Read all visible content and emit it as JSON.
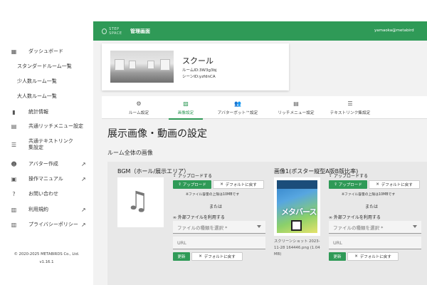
{
  "sidebar": {
    "items": [
      {
        "label": "ダッシュボード",
        "icon": "dashboard-icon"
      },
      {
        "label": "スタンダードルーム一覧"
      },
      {
        "label": "少人数ルーム一覧"
      },
      {
        "label": "大人数ルーム一覧"
      },
      {
        "label": "統計情報",
        "icon": "bar-chart-icon"
      },
      {
        "label": "共通リッチメニュー設定",
        "icon": "book-icon"
      },
      {
        "label": "共通テキストリンク集設定",
        "icon": "list-icon"
      },
      {
        "label": "アバター作成",
        "icon": "avatar-icon"
      },
      {
        "label": "操作マニュアル",
        "icon": "manual-icon"
      },
      {
        "label": "お問い合わせ",
        "icon": "help-icon"
      },
      {
        "label": "利用規約",
        "icon": "document-icon"
      },
      {
        "label": "プライバシーポリシー",
        "icon": "document-icon"
      }
    ],
    "copyright": "© 2020-2025 METABIRDS Co., Ltd.",
    "version": "v1.16.1"
  },
  "header": {
    "logo_text": "STEP SPACE",
    "title": "管理画面",
    "user": "yamaoka@metabird"
  },
  "room": {
    "name": "スクール",
    "room_id": "ルームID:3W3g3bj",
    "scene_id": "シーンID:yzfdnCA"
  },
  "tabs": [
    {
      "label": "ルーム設定",
      "icon": "gear-icon"
    },
    {
      "label": "画像設定",
      "icon": "image-icon"
    },
    {
      "label": "アバターボット™設定",
      "icon": "people-icon"
    },
    {
      "label": "リッチメニュー設定",
      "icon": "book-icon"
    },
    {
      "label": "テキストリンク集設定",
      "icon": "list-icon"
    }
  ],
  "page_title": "展示画像・動画の設定",
  "section_title": "ルーム全体の画像",
  "slots": [
    {
      "title": "BGM（ホール/展示エリア）",
      "upload_head": "アップロードする",
      "upload_btn": "アップロード",
      "default_btn": "デフォルトに戻す",
      "limit_note": "※ファイル容量の上限は10MBです",
      "or": "または",
      "external_head": "外部ファイルを利用する",
      "select_placeholder": "ファイルの種類を選択 *",
      "url_placeholder": "URL",
      "update_btn": "更新",
      "default_btn2": "デフォルトに戻す"
    },
    {
      "title": "画像1(ポスター縦型A版B版比率)",
      "poster_title": "メタバース",
      "caption": "スクリーンショット 2023-11-28 164446.png (1.04 MB)",
      "upload_head": "アップロードする",
      "upload_btn": "アップロード",
      "default_btn": "デフォルトに戻す",
      "limit_note": "※ファイル容量の上限は10MBです",
      "or": "または",
      "external_head": "外部ファイルを利用する",
      "select_placeholder": "ファイルの種類を選択 *",
      "url_placeholder": "URL",
      "update_btn": "更新",
      "default_btn2": "デフォルトに戻す"
    }
  ],
  "colors": {
    "accent": "#2f9a57",
    "header": "#2f9a57",
    "panel": "#e8e8e8"
  }
}
